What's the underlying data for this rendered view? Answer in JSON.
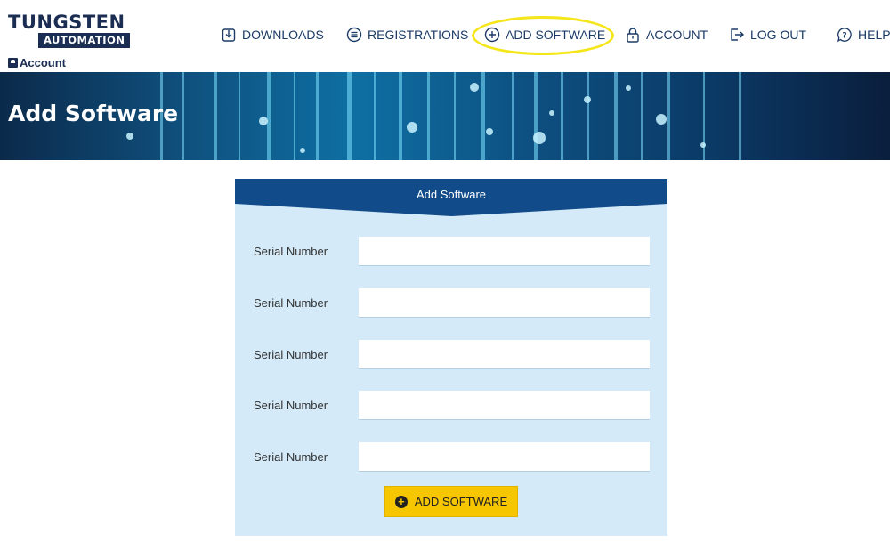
{
  "brand": {
    "line1": "TUNGSTEN",
    "line2": "AUTOMATION"
  },
  "account_link": {
    "label": "Account"
  },
  "nav": {
    "downloads": "DOWNLOADS",
    "registrations": "REGISTRATIONS",
    "add_software": "ADD SOFTWARE",
    "account": "ACCOUNT",
    "log_out": "LOG OUT",
    "help": "HELP"
  },
  "banner": {
    "title": "Add Software"
  },
  "form": {
    "title": "Add Software",
    "fields": [
      {
        "label": "Serial Number",
        "value": ""
      },
      {
        "label": "Serial Number",
        "value": ""
      },
      {
        "label": "Serial Number",
        "value": ""
      },
      {
        "label": "Serial Number",
        "value": ""
      },
      {
        "label": "Serial Number",
        "value": ""
      }
    ],
    "submit_label": "ADD SOFTWARE"
  },
  "colors": {
    "brand_navy": "#1b2d52",
    "card_bg": "#d4eaf8",
    "card_header": "#124b8a",
    "button": "#f6c700",
    "highlight": "#f5e61c"
  }
}
